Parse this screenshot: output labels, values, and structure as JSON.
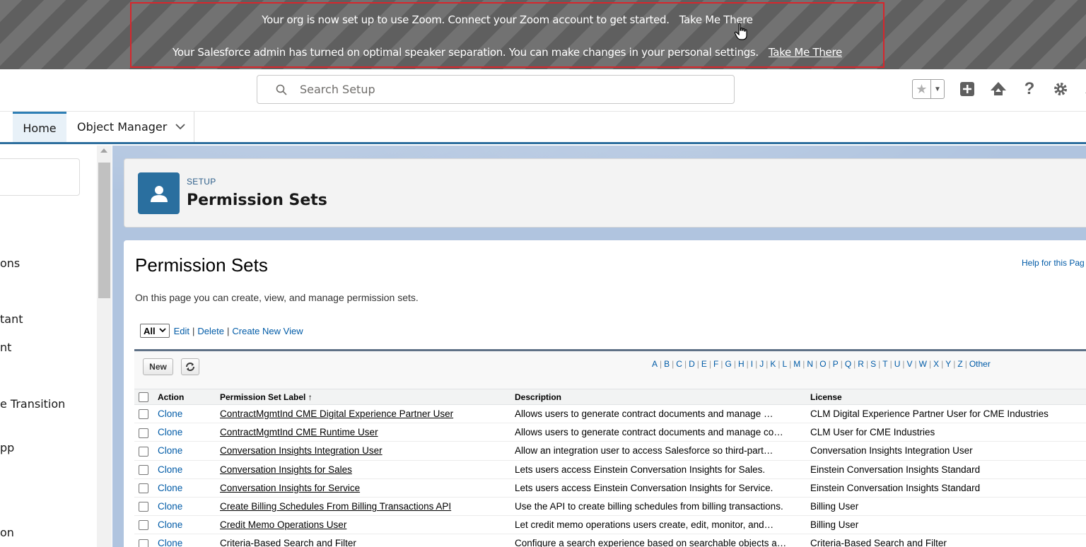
{
  "banner": {
    "line1_text": "Your org is now set up to use Zoom. Connect your Zoom account to get started.",
    "line1_link": "Take Me There",
    "line2_text": "Your Salesforce admin has turned on optimal speaker separation. You can make changes in your personal settings.",
    "line2_link": "Take Me There"
  },
  "header": {
    "search_placeholder": "Search Setup"
  },
  "nav": {
    "tabs": [
      {
        "label": "Home"
      },
      {
        "label": "Object Manager"
      }
    ]
  },
  "sidebar": {
    "items": [
      "ons",
      "tant",
      "nt",
      "e Transition",
      "pp",
      "on"
    ]
  },
  "setup_header": {
    "label": "SETUP",
    "title": "Permission Sets"
  },
  "page": {
    "heading": "Permission Sets",
    "help_link": "Help for this Pag",
    "description": "On this page you can create, view, and manage permission sets.",
    "view_selected": "All",
    "view_links": [
      "Edit",
      "Delete",
      "Create New View"
    ],
    "new_button": "New"
  },
  "alpha_filter": [
    "A",
    "B",
    "C",
    "D",
    "E",
    "F",
    "G",
    "H",
    "I",
    "J",
    "K",
    "L",
    "M",
    "N",
    "O",
    "P",
    "Q",
    "R",
    "S",
    "T",
    "U",
    "V",
    "W",
    "X",
    "Y",
    "Z",
    "Other"
  ],
  "table": {
    "columns": [
      "Action",
      "Permission Set Label ↑",
      "Description",
      "License"
    ],
    "rows": [
      {
        "action": "Clone",
        "label": "ContractMgmtInd CME Digital Experience Partner User",
        "description": "Allows users to generate contract documents and manage …",
        "license": "CLM Digital Experience Partner User for CME Industries"
      },
      {
        "action": "Clone",
        "label": "ContractMgmtInd CME Runtime User",
        "description": "Allows users to generate contract documents and manage co…",
        "license": "CLM User for CME Industries"
      },
      {
        "action": "Clone",
        "label": "Conversation Insights Integration User",
        "description": "Allow an integration user to access Salesforce so third-part…",
        "license": "Conversation Insights Integration User"
      },
      {
        "action": "Clone",
        "label": "Conversation Insights for Sales",
        "description": "Lets users access Einstein Conversation Insights for Sales.",
        "license": "Einstein Conversation Insights Standard"
      },
      {
        "action": "Clone",
        "label": "Conversation Insights for Service",
        "description": "Lets users access Einstein Conversation Insights for Service.",
        "license": "Einstein Conversation Insights Standard"
      },
      {
        "action": "Clone",
        "label": "Create Billing Schedules From Billing Transactions API",
        "description": "Use the API to create billing schedules from billing transactions.",
        "license": "Billing User"
      },
      {
        "action": "Clone",
        "label": "Credit Memo Operations User",
        "description": "Let credit memo operations users create, edit, monitor, and…",
        "license": "Billing User"
      },
      {
        "action": "Clone",
        "label": "Criteria-Based Search and Filter",
        "description": "Configure a search experience based on searchable objects a…",
        "license": "Criteria-Based Search and Filter"
      }
    ]
  }
}
